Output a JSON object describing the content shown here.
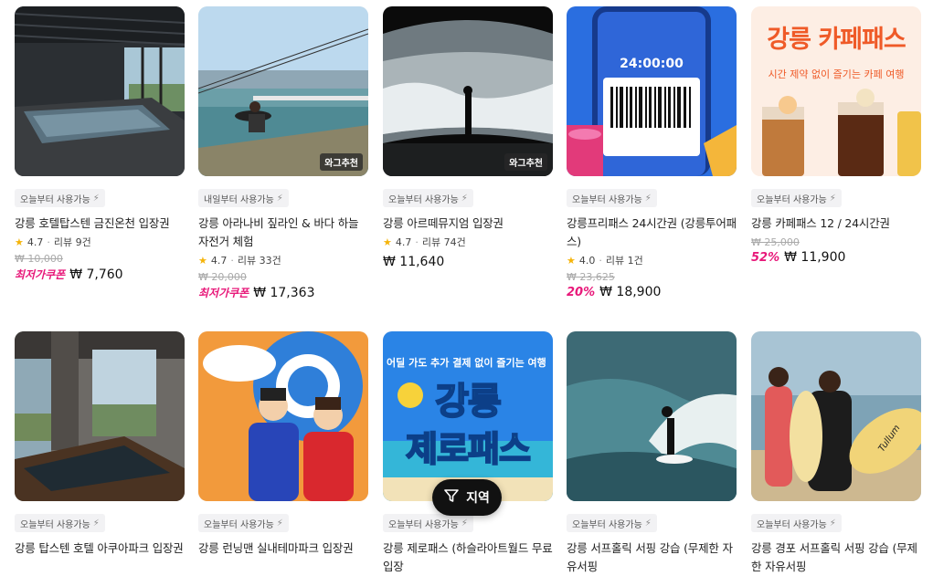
{
  "filter_button": {
    "label": "지역"
  },
  "cards": [
    {
      "badge": "오늘부터 사용가능",
      "title": "강릉 호텔탑스텐 금진온천 입장권",
      "rating": "4.7",
      "reviews": "리뷰 9건",
      "original_price": "₩ 10,000",
      "discount": "최저가쿠폰",
      "price": "₩ 7,760",
      "recommend": ""
    },
    {
      "badge": "내일부터 사용가능",
      "title": "강릉 아라나비 짚라인 & 바다 하늘 자전거 체험",
      "rating": "4.7",
      "reviews": "리뷰 33건",
      "original_price": "₩ 20,000",
      "discount": "최저가쿠폰",
      "price": "₩ 17,363",
      "recommend": "와그추천"
    },
    {
      "badge": "오늘부터 사용가능",
      "title": "강릉 아르떼뮤지엄 입장권",
      "rating": "4.7",
      "reviews": "리뷰 74건",
      "original_price": "",
      "discount": "",
      "price": "₩ 11,640",
      "recommend": "와그추천"
    },
    {
      "badge": "오늘부터 사용가능",
      "title": "강릉프리패스 24시간권 (강릉투어패스)",
      "rating": "4.0",
      "reviews": "리뷰 1건",
      "original_price": "₩ 23,625",
      "discount": "20%",
      "price": "₩ 18,900",
      "recommend": ""
    },
    {
      "badge": "오늘부터 사용가능",
      "title": "강릉 카페패스 12 / 24시간권",
      "rating": "",
      "reviews": "",
      "original_price": "₩ 25,000",
      "discount": "52%",
      "price": "₩ 11,900",
      "recommend": ""
    },
    {
      "badge": "오늘부터 사용가능",
      "title": "강릉 탑스텐 호텔 아쿠아파크 입장권"
    },
    {
      "badge": "오늘부터 사용가능",
      "title": "강릉 런닝맨 실내테마파크 입장권"
    },
    {
      "badge": "오늘부터 사용가능",
      "title": "강릉 제로패스 (하슬라아트월드 무료입장"
    },
    {
      "badge": "오늘부터 사용가능",
      "title": "강릉 서프홀릭 서핑 강습 (무제한 자유서핑"
    },
    {
      "badge": "오늘부터 사용가능",
      "title": "강릉 경포 서프홀릭 서핑 강습 (무제한 자유서핑"
    }
  ],
  "thumb_text": {
    "freepass_timer": "24:00:00",
    "cafepass_heading": "강릉 카페패스",
    "cafepass_sub": "시간 제약 없이 즐기는 카페 여행",
    "zeropass_top": "어딜 가도 추가 결제 없이 즐기는 여행",
    "zeropass_line1": "강릉",
    "zeropass_line2": "제로패스",
    "surfboard_text": "Tullum"
  }
}
